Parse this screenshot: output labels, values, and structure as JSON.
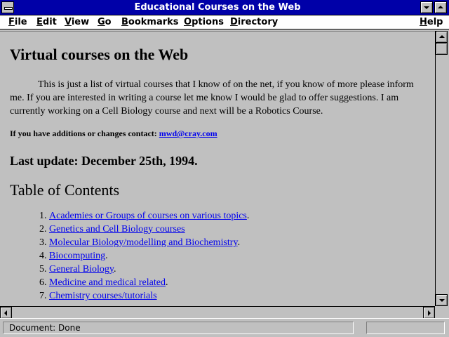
{
  "window": {
    "title": "Educational Courses on the Web",
    "icons": {
      "system": "system-menu-icon",
      "minimize": "minimize-icon",
      "maximize": "maximize-icon"
    }
  },
  "menubar": {
    "items": [
      "File",
      "Edit",
      "View",
      "Go",
      "Bookmarks",
      "Options",
      "Directory"
    ],
    "help": "Help"
  },
  "page": {
    "heading": "Virtual courses on the Web",
    "intro": "This is just a list of virtual courses that I know of on the net, if you know of more please inform me. If you are interested in writing a course let me know I would be glad to offer suggestions. I am currently working on a Cell Biology course and next will be a Robotics Course.",
    "contact_label": "If you have additions or changes contact:",
    "contact_email": "mwd@cray.com",
    "last_update": "Last update: December 25th, 1994.",
    "toc_heading": "Table of Contents",
    "toc": [
      "Academies or Groups of courses on various topics",
      "Genetics and Cell Biology courses",
      "Molecular Biology/modelling and Biochemistry",
      "Biocomputing",
      "General Biology",
      "Medicine and medical related",
      "Chemistry courses/tutorials"
    ]
  },
  "status": {
    "text": "Document: Done"
  },
  "colors": {
    "titlebar": "#0000a8",
    "background": "#c0c0c0",
    "link": "#0000ee"
  }
}
